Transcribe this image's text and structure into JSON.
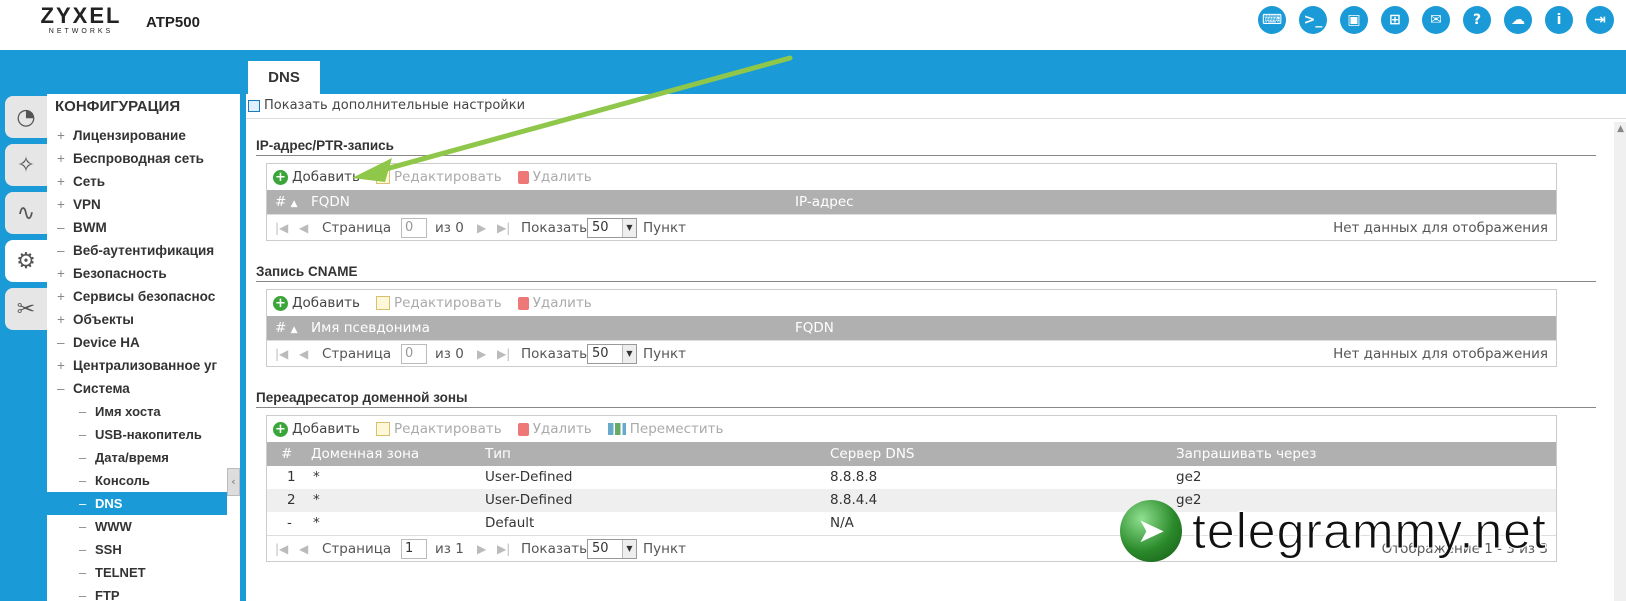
{
  "header": {
    "logo_main": "ZYXEL",
    "logo_sub": "NETWORKS",
    "model": "ATP500",
    "icons": [
      {
        "name": "console-icon",
        "glyph": "⌨"
      },
      {
        "name": "cli-icon",
        "glyph": ">_"
      },
      {
        "name": "window-icon",
        "glyph": "▣"
      },
      {
        "name": "sitemap-icon",
        "glyph": "⊞"
      },
      {
        "name": "message-icon",
        "glyph": "✉"
      },
      {
        "name": "help-icon",
        "glyph": "?"
      },
      {
        "name": "cloud-icon",
        "glyph": "☁"
      },
      {
        "name": "info-icon",
        "glyph": "i"
      },
      {
        "name": "logout-icon",
        "glyph": "⇥"
      }
    ]
  },
  "tab": {
    "label": "DNS"
  },
  "sidebar_icons": [
    {
      "name": "dashboard-icon",
      "glyph": "◔"
    },
    {
      "name": "wizard-icon",
      "glyph": "✧"
    },
    {
      "name": "monitor-icon",
      "glyph": "∿"
    },
    {
      "name": "gear-icon",
      "glyph": "⚙"
    },
    {
      "name": "tools-icon",
      "glyph": "✂"
    }
  ],
  "nav": {
    "title": "КОНФИГУРАЦИЯ",
    "items": [
      {
        "label": "Лицензирование",
        "pm": "+",
        "sub": false,
        "sel": false
      },
      {
        "label": "Беспроводная сеть",
        "pm": "+",
        "sub": false,
        "sel": false
      },
      {
        "label": "Сеть",
        "pm": "+",
        "sub": false,
        "sel": false
      },
      {
        "label": "VPN",
        "pm": "+",
        "sub": false,
        "sel": false
      },
      {
        "label": "BWM",
        "pm": "–",
        "sub": false,
        "sel": false
      },
      {
        "label": "Веб-аутентификация",
        "pm": "–",
        "sub": false,
        "sel": false
      },
      {
        "label": "Безопасность",
        "pm": "+",
        "sub": false,
        "sel": false
      },
      {
        "label": "Сервисы безопаснос",
        "pm": "+",
        "sub": false,
        "sel": false
      },
      {
        "label": "Объекты",
        "pm": "+",
        "sub": false,
        "sel": false
      },
      {
        "label": "Device HA",
        "pm": "–",
        "sub": false,
        "sel": false
      },
      {
        "label": "Централизованное уг",
        "pm": "+",
        "sub": false,
        "sel": false
      },
      {
        "label": "Система",
        "pm": "–",
        "sub": false,
        "sel": false
      },
      {
        "label": "Имя хоста",
        "pm": "–",
        "sub": true,
        "sel": false
      },
      {
        "label": "USB-накопитель",
        "pm": "–",
        "sub": true,
        "sel": false
      },
      {
        "label": "Дата/время",
        "pm": "–",
        "sub": true,
        "sel": false
      },
      {
        "label": "Консоль",
        "pm": "–",
        "sub": true,
        "sel": false
      },
      {
        "label": "DNS",
        "pm": "–",
        "sub": true,
        "sel": true
      },
      {
        "label": "WWW",
        "pm": "–",
        "sub": true,
        "sel": false
      },
      {
        "label": "SSH",
        "pm": "–",
        "sub": true,
        "sel": false
      },
      {
        "label": "TELNET",
        "pm": "–",
        "sub": true,
        "sel": false
      },
      {
        "label": "FTP",
        "pm": "–",
        "sub": true,
        "sel": false
      }
    ]
  },
  "advanced": "Показать дополнительные настройки",
  "toolbar": {
    "add": "Добавить",
    "edit": "Редактировать",
    "delete": "Удалить",
    "move": "Переместить"
  },
  "pager": {
    "page": "Страница",
    "of": "из",
    "show": "Показать",
    "per_page": "50",
    "items": "Пункт"
  },
  "section1": {
    "title": "IP-адрес/PTR-запись",
    "col_num": "#",
    "col1": "FQDN",
    "col2": "IP-адрес",
    "page_value": "0",
    "total": "0",
    "status": "Нет данных для отображения"
  },
  "section2": {
    "title": "Запись CNAME",
    "col_num": "#",
    "col1": "Имя псевдонима",
    "col2": "FQDN",
    "page_value": "0",
    "total": "0",
    "status": "Нет данных для отображения"
  },
  "section3": {
    "title": "Переадресатор доменной зоны",
    "col_num": "#",
    "cols": [
      "Доменная зона",
      "Тип",
      "Сервер DNS",
      "Запрашивать через"
    ],
    "rows": [
      [
        "1",
        "*",
        "User-Defined",
        "8.8.8.8",
        "ge2"
      ],
      [
        "2",
        "*",
        "User-Defined",
        "8.8.4.4",
        "ge2"
      ],
      [
        "-",
        "*",
        "Default",
        "N/A",
        ""
      ]
    ],
    "page_value": "1",
    "total": "1",
    "status": "Отображение 1 - 3 из 3"
  },
  "watermark": "telegrammy.net"
}
